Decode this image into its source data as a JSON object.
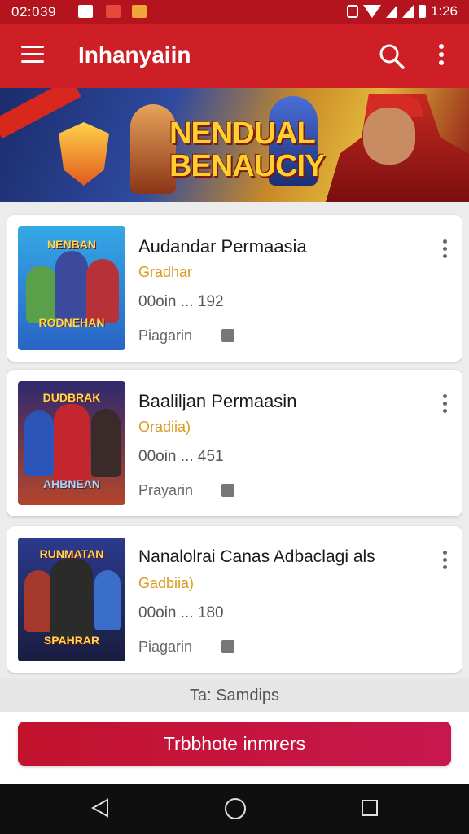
{
  "status_bar": {
    "time": "02:039",
    "battery_text": "1:26"
  },
  "app_bar": {
    "title": "Inhanyaiin"
  },
  "banner": {
    "ribbon_text": "",
    "shield_text": "",
    "headline_line1": "NENDUAL",
    "headline_line2": "BENAUCIY",
    "active_slide": 2,
    "slide_count": 3
  },
  "items": [
    {
      "name": "Audandar Permaasia",
      "genre": "Gradhar",
      "meta": "00oin ... 192",
      "action": "Piagarin",
      "thumb_title": "NENBAN",
      "thumb_caption": "RODNEHAN"
    },
    {
      "name": "Baaliljan Permaasin",
      "genre": "Oradiia)",
      "meta": "00oin ... 451",
      "action": "Prayarin",
      "thumb_title": "DUDBRAK",
      "thumb_caption": "AHBNEAN"
    },
    {
      "name": "Nanalolrai Canas Adbaclagi als",
      "genre": "Gadbiia)",
      "meta": "00oin ... 180",
      "action": "Piagarin",
      "thumb_title": "RUNMATAN",
      "thumb_caption": "SPAHRAR"
    }
  ],
  "tab_hint": "Ta: Samdips",
  "cta_label": "Trbbhote inmrers",
  "colors": {
    "app_bar": "#cf1f26",
    "status_bar": "#b3141d",
    "cta": "#c2122c",
    "genre": "#d99a1e"
  }
}
